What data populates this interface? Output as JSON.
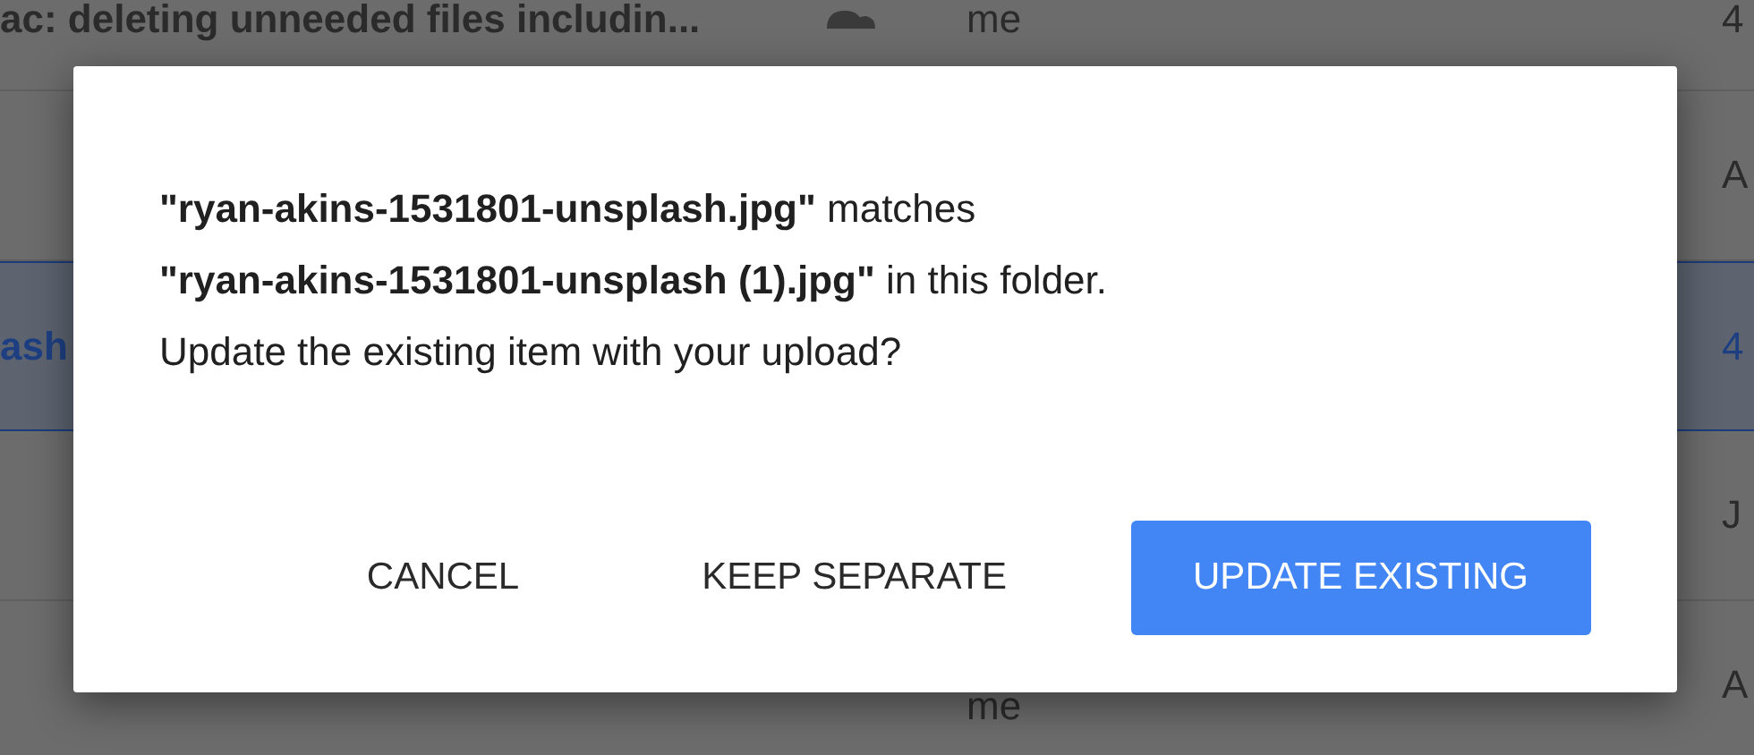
{
  "background_rows": [
    {
      "name": "ac: deleting unneeded files includin...",
      "shared": true,
      "owner": "me",
      "column_3": "4",
      "selected": false
    },
    {
      "shared": false,
      "column_3": "A",
      "selected": false
    },
    {
      "name": "ash",
      "shared": false,
      "column_3": "4",
      "selected": true
    },
    {
      "shared": false,
      "column_3": "J",
      "selected": false
    },
    {
      "shared": false,
      "owner": "me",
      "column_3": "A",
      "selected": false
    }
  ],
  "dialog": {
    "message": "**\"ryan-akins-1531801-unsplash.jpg\"** matches **\"ryan-akins-1531801-unsplash (1).jpg\"** in this folder. Update the existing item with your upload?",
    "buttons": [
      {
        "label": "CANCEL",
        "kind": "text"
      },
      {
        "label": "KEEP SEPARATE",
        "kind": "text"
      },
      {
        "label": "UPDATE EXISTING",
        "kind": "primary"
      }
    ]
  }
}
